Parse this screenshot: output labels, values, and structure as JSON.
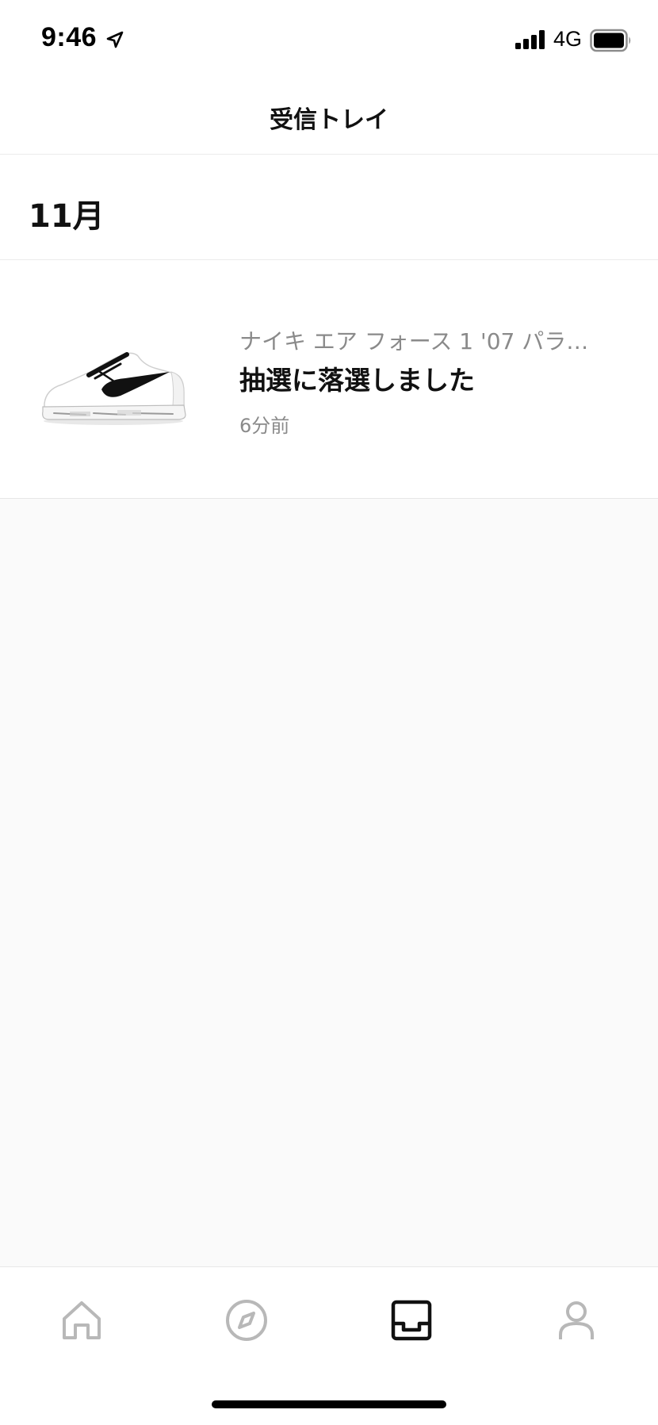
{
  "status_bar": {
    "time": "9:46",
    "network": "4G",
    "icons": [
      "location-arrow-icon",
      "signal-bars-icon",
      "battery-full-icon"
    ]
  },
  "header": {
    "title": "受信トレイ"
  },
  "section": {
    "title": "11月"
  },
  "inbox_items": [
    {
      "image": "sneaker-thumbnail",
      "subtitle": "ナイキ エア フォース 1 '07 パラ…",
      "title": "抽選に落選しました",
      "time": "6分前"
    }
  ],
  "tab_bar": {
    "tabs": [
      {
        "icon": "home-icon",
        "active": false
      },
      {
        "icon": "compass-icon",
        "active": false
      },
      {
        "icon": "inbox-icon",
        "active": true
      },
      {
        "icon": "profile-icon",
        "active": false
      }
    ],
    "colors": {
      "active": "#111111",
      "inactive": "#b8b8b8"
    }
  }
}
